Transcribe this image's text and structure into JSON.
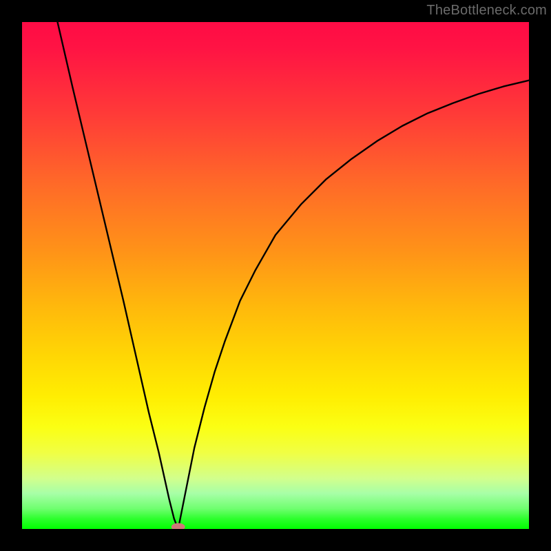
{
  "watermark": "TheBottleneck.com",
  "chart_data": {
    "type": "line",
    "title": "",
    "xlabel": "",
    "ylabel": "",
    "xlim": [
      0,
      100
    ],
    "ylim": [
      0,
      100
    ],
    "grid": false,
    "legend": false,
    "series": [
      {
        "name": "left-branch",
        "x": [
          7,
          10,
          15,
          20,
          25,
          27,
          29,
          30,
          30.8
        ],
        "values": [
          100,
          87,
          66,
          45,
          23,
          15,
          6,
          2,
          0
        ]
      },
      {
        "name": "right-branch",
        "x": [
          30.8,
          32,
          34,
          36,
          38,
          40,
          43,
          46,
          50,
          55,
          60,
          65,
          70,
          75,
          80,
          85,
          90,
          95,
          100
        ],
        "values": [
          0,
          6,
          16,
          24,
          31,
          37,
          45,
          51,
          58,
          64,
          69,
          73,
          76.5,
          79.5,
          82,
          84,
          85.8,
          87.3,
          88.5
        ]
      }
    ],
    "marker": {
      "name": "minimum-point",
      "x": 30.8,
      "y": 0,
      "color": "#d46a6a",
      "size": 8
    },
    "background_gradient": {
      "top": "#ff0b45",
      "upper_mid": "#ff9218",
      "mid": "#ffee02",
      "lower_mid": "#d2ff8c",
      "bottom": "#00ff00"
    }
  }
}
